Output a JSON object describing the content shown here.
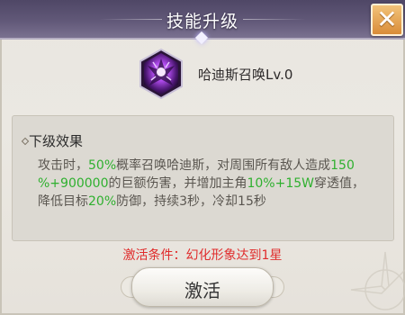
{
  "header": {
    "title": "技能升级",
    "close_label": "✕"
  },
  "skill": {
    "name": "哈迪斯召唤Lv.0",
    "icon": "purple-summon-demon-icon"
  },
  "effect": {
    "title": "下级效果",
    "line1_a": "攻击时，",
    "line1_b": "50%",
    "line1_c": "概率召唤哈迪斯，对周围所有敌人造成",
    "line1_d": "150",
    "line2_a": "%+900000",
    "line2_b": "的巨额伤害，并增加主角",
    "line2_c": "10%+15W",
    "line2_d": "穿透值，",
    "line3_a": "降低目标",
    "line3_b": "20%",
    "line3_c": "防御，持续3秒，冷却15秒"
  },
  "activation": {
    "condition": "激活条件：幻化形象达到1星",
    "button_label": "激活"
  },
  "colors": {
    "highlight_green": "#2fb02f",
    "condition_red": "#e02c2c",
    "close_orange": "#d98c38",
    "header_purple": "#615878"
  }
}
